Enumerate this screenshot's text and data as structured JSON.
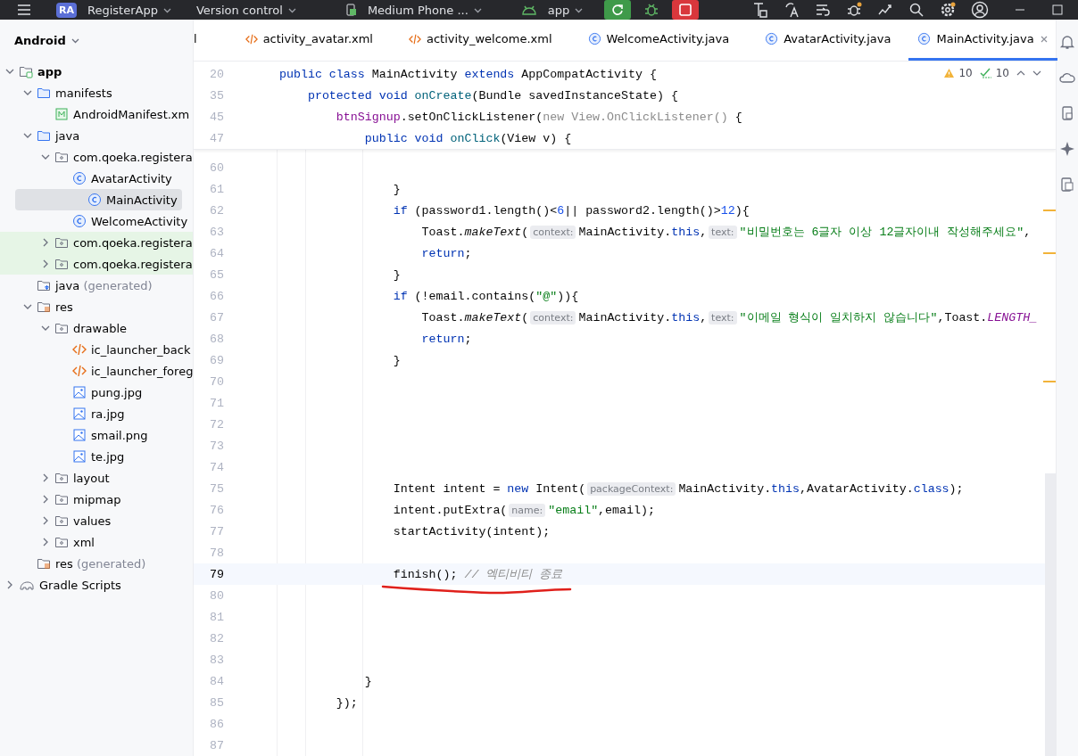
{
  "title_bar": {
    "project_badge": "RA",
    "project": "RegisterApp",
    "vcs": "Version control",
    "device": "Medium Phone ...",
    "run_config": "app"
  },
  "project_panel": {
    "title": "Android",
    "tree": [
      {
        "label": "app",
        "kind": "module",
        "bold": true,
        "expanded": true,
        "selected": false,
        "children": [
          {
            "label": "manifests",
            "kind": "folder",
            "expanded": true,
            "selected": false,
            "children": [
              {
                "label": "AndroidManifest.xm",
                "kind": "manifest",
                "selected": false
              }
            ]
          },
          {
            "label": "java",
            "kind": "folder",
            "expanded": true,
            "selected": false,
            "children": [
              {
                "label": "com.qoeka.registera",
                "kind": "package",
                "expanded": true,
                "selected": false,
                "children": [
                  {
                    "label": "AvatarActivity",
                    "kind": "class",
                    "selected": false
                  },
                  {
                    "label": "MainActivity",
                    "kind": "class",
                    "selected": true
                  },
                  {
                    "label": "WelcomeActivity",
                    "kind": "class",
                    "selected": false
                  }
                ]
              },
              {
                "label": "com.qoeka.registera",
                "kind": "package",
                "expanded": false,
                "test": true,
                "selected": false
              },
              {
                "label": "com.qoeka.registera",
                "kind": "package",
                "expanded": false,
                "test": true,
                "selected": false
              }
            ]
          },
          {
            "label": "java",
            "suffix": "(generated)",
            "kind": "gen",
            "selected": false
          },
          {
            "label": "res",
            "kind": "res",
            "expanded": true,
            "selected": false,
            "children": [
              {
                "label": "drawable",
                "kind": "package",
                "expanded": true,
                "selected": false,
                "children": [
                  {
                    "label": "ic_launcher_back",
                    "kind": "xml",
                    "selected": false
                  },
                  {
                    "label": "ic_launcher_foreg",
                    "kind": "xml",
                    "selected": false
                  },
                  {
                    "label": "pung.jpg",
                    "kind": "image",
                    "selected": false
                  },
                  {
                    "label": "ra.jpg",
                    "kind": "image",
                    "selected": false
                  },
                  {
                    "label": "smail.png",
                    "kind": "image",
                    "selected": false
                  },
                  {
                    "label": "te.jpg",
                    "kind": "image",
                    "selected": false
                  }
                ]
              },
              {
                "label": "layout",
                "kind": "package",
                "expanded": false,
                "selected": false
              },
              {
                "label": "mipmap",
                "kind": "package",
                "expanded": false,
                "selected": false
              },
              {
                "label": "values",
                "kind": "package",
                "expanded": false,
                "selected": false
              },
              {
                "label": "xml",
                "kind": "package",
                "expanded": false,
                "selected": false
              }
            ]
          },
          {
            "label": "res",
            "suffix": "(generated)",
            "kind": "res",
            "selected": false
          }
        ]
      },
      {
        "label": "Gradle Scripts",
        "kind": "gradle",
        "expanded": false,
        "selected": false
      }
    ]
  },
  "tabs": [
    {
      "label": "l",
      "kind": "none",
      "selected": false
    },
    {
      "label": "activity_avatar.xml",
      "kind": "xml",
      "selected": false
    },
    {
      "label": "activity_welcome.xml",
      "kind": "xml",
      "selected": false
    },
    {
      "label": "WelcomeActivity.java",
      "kind": "class",
      "selected": false
    },
    {
      "label": "AvatarActivity.java",
      "kind": "class",
      "selected": false
    },
    {
      "label": "MainActivity.java",
      "kind": "class",
      "selected": true
    }
  ],
  "inspections": {
    "warnings": "10",
    "weak_warnings": "10"
  },
  "sticky_lines": [
    {
      "number": "20",
      "tokens": [
        {
          "t": "public class ",
          "kind": "kw"
        },
        {
          "t": "MainActivity ",
          "kind": "plain"
        },
        {
          "t": "extends ",
          "kind": "kw"
        },
        {
          "t": "AppCompatActivity {",
          "kind": "plain"
        }
      ]
    },
    {
      "number": "35",
      "tokens": [
        {
          "t": "    protected void ",
          "kind": "kw"
        },
        {
          "t": "onCreate",
          "kind": "meth"
        },
        {
          "t": "(Bundle savedInstanceState) {",
          "kind": "plain"
        }
      ]
    },
    {
      "number": "45",
      "tokens": [
        {
          "t": "        btnSignup",
          "kind": "var"
        },
        {
          "t": ".setOnClickListener(",
          "kind": "plain"
        },
        {
          "t": "new View.OnClickListener()",
          "kind": "dim"
        },
        {
          "t": " {",
          "kind": "plain"
        }
      ]
    },
    {
      "number": "47",
      "tokens": [
        {
          "t": "            public void ",
          "kind": "kw"
        },
        {
          "t": "onClick",
          "kind": "meth"
        },
        {
          "t": "(View v) {",
          "kind": "plain"
        }
      ]
    }
  ],
  "lines": [
    {
      "number": "60",
      "current": false,
      "warn": false
    },
    {
      "number": "61",
      "current": false,
      "warn": false,
      "tokens": [
        {
          "t": "                }",
          "kind": "plain"
        }
      ]
    },
    {
      "number": "62",
      "current": false,
      "warn": true,
      "tokens": [
        {
          "t": "                if ",
          "kind": "kw"
        },
        {
          "t": "(password1.length()<",
          "kind": "plain"
        },
        {
          "t": "6",
          "kind": "num"
        },
        {
          "t": "|| password2.length()>",
          "kind": "plain"
        },
        {
          "t": "12",
          "kind": "num"
        },
        {
          "t": "){",
          "kind": "plain"
        }
      ]
    },
    {
      "number": "63",
      "current": false,
      "warn": false,
      "tokens": [
        {
          "t": "                    Toast.",
          "kind": "plain"
        },
        {
          "t": "makeText",
          "kind": "ital"
        },
        {
          "t": "(",
          "kind": "plain"
        },
        {
          "t": "context:",
          "kind": "hint"
        },
        {
          "t": "MainActivity.",
          "kind": "plain"
        },
        {
          "t": "this",
          "kind": "kw"
        },
        {
          "t": ",",
          "kind": "plain"
        },
        {
          "t": "text:",
          "kind": "hint"
        },
        {
          "t": "\"비밀번호는 6글자 이상 12글자이내 작성해주세요\"",
          "kind": "str"
        },
        {
          "t": ",",
          "kind": "plain"
        }
      ]
    },
    {
      "number": "64",
      "current": false,
      "warn": true,
      "tokens": [
        {
          "t": "                    return",
          "kind": "kw"
        },
        {
          "t": ";",
          "kind": "plain"
        }
      ]
    },
    {
      "number": "65",
      "current": false,
      "warn": false,
      "tokens": [
        {
          "t": "                }",
          "kind": "plain"
        }
      ]
    },
    {
      "number": "66",
      "current": false,
      "warn": false,
      "tokens": [
        {
          "t": "                if ",
          "kind": "kw"
        },
        {
          "t": "(!email.contains(",
          "kind": "plain"
        },
        {
          "t": "\"@\"",
          "kind": "str"
        },
        {
          "t": ")){",
          "kind": "plain"
        }
      ]
    },
    {
      "number": "67",
      "current": false,
      "warn": false,
      "tokens": [
        {
          "t": "                    Toast.",
          "kind": "plain"
        },
        {
          "t": "makeText",
          "kind": "ital"
        },
        {
          "t": "(",
          "kind": "plain"
        },
        {
          "t": "context:",
          "kind": "hint"
        },
        {
          "t": "MainActivity.",
          "kind": "plain"
        },
        {
          "t": "this",
          "kind": "kw"
        },
        {
          "t": ",",
          "kind": "plain"
        },
        {
          "t": "text:",
          "kind": "hint"
        },
        {
          "t": "\"이메일 형식이 일치하지 않습니다\"",
          "kind": "str"
        },
        {
          "t": ",Toast.",
          "kind": "plain"
        },
        {
          "t": "LENGTH_",
          "kind": "fld"
        }
      ]
    },
    {
      "number": "68",
      "current": false,
      "warn": false,
      "tokens": [
        {
          "t": "                    return",
          "kind": "kw"
        },
        {
          "t": ";",
          "kind": "plain"
        }
      ]
    },
    {
      "number": "69",
      "current": false,
      "warn": false,
      "tokens": [
        {
          "t": "                }",
          "kind": "plain"
        }
      ]
    },
    {
      "number": "70",
      "current": false,
      "warn": true
    },
    {
      "number": "71",
      "current": false,
      "warn": false
    },
    {
      "number": "72",
      "current": false,
      "warn": false
    },
    {
      "number": "73",
      "current": false,
      "warn": false
    },
    {
      "number": "74",
      "current": false,
      "warn": false
    },
    {
      "number": "75",
      "current": false,
      "warn": false,
      "tokens": [
        {
          "t": "                Intent intent = ",
          "kind": "plain"
        },
        {
          "t": "new ",
          "kind": "kw"
        },
        {
          "t": "Intent(",
          "kind": "plain"
        },
        {
          "t": "packageContext:",
          "kind": "hint"
        },
        {
          "t": "MainActivity.",
          "kind": "plain"
        },
        {
          "t": "this",
          "kind": "kw"
        },
        {
          "t": ",AvatarActivity.",
          "kind": "plain"
        },
        {
          "t": "class",
          "kind": "kw"
        },
        {
          "t": ");",
          "kind": "plain"
        }
      ]
    },
    {
      "number": "76",
      "current": false,
      "warn": false,
      "tokens": [
        {
          "t": "                intent.putExtra(",
          "kind": "plain"
        },
        {
          "t": "name:",
          "kind": "hint"
        },
        {
          "t": "\"email\"",
          "kind": "str"
        },
        {
          "t": ",email);",
          "kind": "plain"
        }
      ]
    },
    {
      "number": "77",
      "current": false,
      "warn": false,
      "tokens": [
        {
          "t": "                startActivity(intent);",
          "kind": "plain"
        }
      ]
    },
    {
      "number": "78",
      "current": false,
      "warn": false
    },
    {
      "number": "79",
      "current": true,
      "warn": false,
      "tokens": [
        {
          "t": "                finish(); ",
          "kind": "plain"
        },
        {
          "t": "// 엑티비티 종료",
          "kind": "cmt"
        }
      ]
    },
    {
      "number": "80",
      "current": false,
      "warn": false
    },
    {
      "number": "81",
      "current": false,
      "warn": false
    },
    {
      "number": "82",
      "current": false,
      "warn": false
    },
    {
      "number": "83",
      "current": false,
      "warn": false
    },
    {
      "number": "84",
      "current": false,
      "warn": false,
      "tokens": [
        {
          "t": "            }",
          "kind": "plain"
        }
      ]
    },
    {
      "number": "85",
      "current": false,
      "warn": false,
      "tokens": [
        {
          "t": "        });",
          "kind": "plain"
        }
      ]
    },
    {
      "number": "86",
      "current": false,
      "warn": false
    },
    {
      "number": "87",
      "current": false,
      "warn": false
    }
  ]
}
